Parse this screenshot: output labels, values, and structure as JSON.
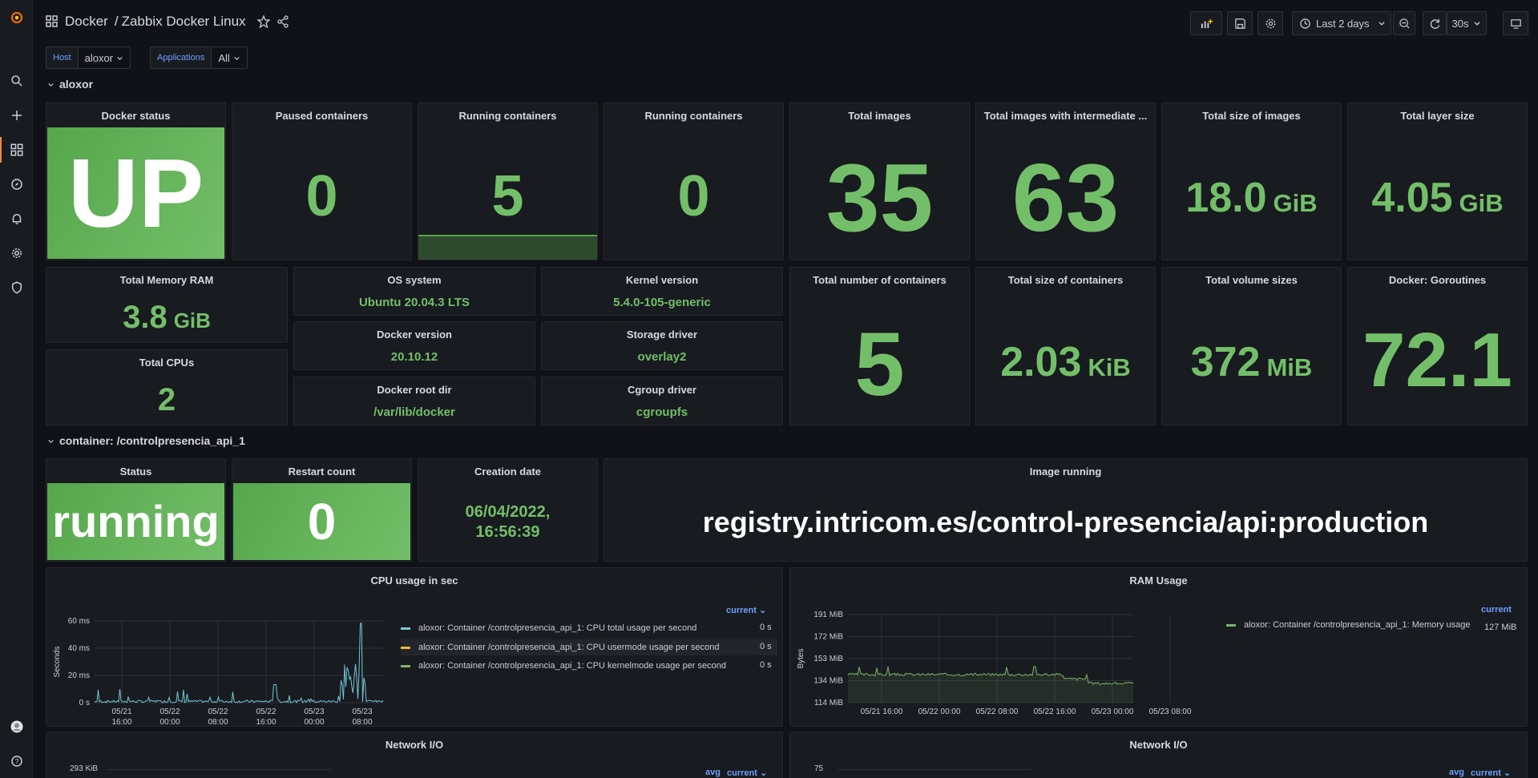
{
  "header": {
    "folder": "Docker",
    "separator": "/",
    "dashboard_title": "Zabbix Docker Linux",
    "time_range": "Last 2 days",
    "refresh": "30s"
  },
  "variables": [
    {
      "label": "Host",
      "value": "aloxor"
    },
    {
      "label": "Applications",
      "value": "All"
    }
  ],
  "rows": {
    "host": "aloxor",
    "container": "container: /controlpresencia_api_1"
  },
  "stats": {
    "docker_status": {
      "title": "Docker status",
      "value": "UP"
    },
    "paused": {
      "title": "Paused containers",
      "value": "0"
    },
    "running1": {
      "title": "Running containers",
      "value": "5"
    },
    "running2": {
      "title": "Running containers",
      "value": "0"
    },
    "total_images": {
      "title": "Total images",
      "value": "35"
    },
    "total_images_int": {
      "title": "Total images with intermediate ...",
      "value": "63"
    },
    "total_size_images": {
      "title": "Total size of images",
      "value": "18.0",
      "unit": "GiB"
    },
    "total_layer": {
      "title": "Total layer size",
      "value": "4.05",
      "unit": "GiB"
    },
    "memory": {
      "title": "Total Memory RAM",
      "value": "3.8",
      "unit": "GiB"
    },
    "cpus": {
      "title": "Total CPUs",
      "value": "2"
    },
    "os": {
      "title": "OS system",
      "value": "Ubuntu 20.04.3 LTS"
    },
    "kernel": {
      "title": "Kernel version",
      "value": "5.4.0-105-generic"
    },
    "docker_version": {
      "title": "Docker version",
      "value": "20.10.12"
    },
    "storage": {
      "title": "Storage driver",
      "value": "overlay2"
    },
    "rootdir": {
      "title": "Docker root dir",
      "value": "/var/lib/docker"
    },
    "cgroup": {
      "title": "Cgroup driver",
      "value": "cgroupfs"
    },
    "num_containers": {
      "title": "Total number of containers",
      "value": "5"
    },
    "size_containers": {
      "title": "Total size of containers",
      "value": "2.03",
      "unit": "KiB"
    },
    "volume_sizes": {
      "title": "Total volume sizes",
      "value": "372",
      "unit": "MiB"
    },
    "goroutines": {
      "title": "Docker: Goroutines",
      "value": "72.1"
    }
  },
  "container": {
    "status": {
      "title": "Status",
      "value": "running"
    },
    "restart": {
      "title": "Restart count",
      "value": "0"
    },
    "creation": {
      "title": "Creation date",
      "value_line1": "06/04/2022,",
      "value_line2": "16:56:39"
    },
    "image": {
      "title": "Image running",
      "value": "registry.intricom.es/control-presencia/api:production"
    }
  },
  "cpu_panel": {
    "title": "CPU usage in sec",
    "legend_header": "current",
    "legend": [
      {
        "name": "aloxor: Container /controlpresencia_api_1: CPU total usage per second",
        "value": "0 s",
        "color": "#73c6d6"
      },
      {
        "name": "aloxor: Container /controlpresencia_api_1: CPU usermode usage per second",
        "value": "0 s",
        "color": "#eab839"
      },
      {
        "name": "aloxor: Container /controlpresencia_api_1: CPU kernelmode usage per second",
        "value": "0 s",
        "color": "#7eb26d"
      }
    ],
    "ylabel": "Seconds",
    "yticks": [
      "60 ms",
      "40 ms",
      "20 ms",
      "0 s"
    ],
    "xticks": [
      [
        "05/21",
        "16:00"
      ],
      [
        "05/22",
        "00:00"
      ],
      [
        "05/22",
        "08:00"
      ],
      [
        "05/22",
        "16:00"
      ],
      [
        "05/23",
        "00:00"
      ],
      [
        "05/23",
        "08:00"
      ]
    ]
  },
  "ram_panel": {
    "title": "RAM Usage",
    "legend_header": "current",
    "legend": [
      {
        "name": "aloxor: Container /controlpresencia_api_1: Memory usage",
        "value": "127 MiB",
        "color": "#7eb26d"
      }
    ],
    "ylabel": "Bytes",
    "yticks": [
      "191 MiB",
      "172 MiB",
      "153 MiB",
      "134 MiB",
      "114 MiB"
    ],
    "xticks": [
      "05/21 16:00",
      "05/22 00:00",
      "05/22 08:00",
      "05/22 16:00",
      "05/23 00:00",
      "05/23 08:00"
    ]
  },
  "net1": {
    "title": "Network I/O",
    "ytop": "293 KiB",
    "legend_avg": "avg",
    "legend_current": "current"
  },
  "net2": {
    "title": "Network I/O",
    "ytop": "75",
    "legend_avg": "avg",
    "legend_current": "current"
  },
  "colors": {
    "green": "#73bf69",
    "panel": "#181b1f",
    "bg": "#111217",
    "accent": "#ff8833"
  }
}
